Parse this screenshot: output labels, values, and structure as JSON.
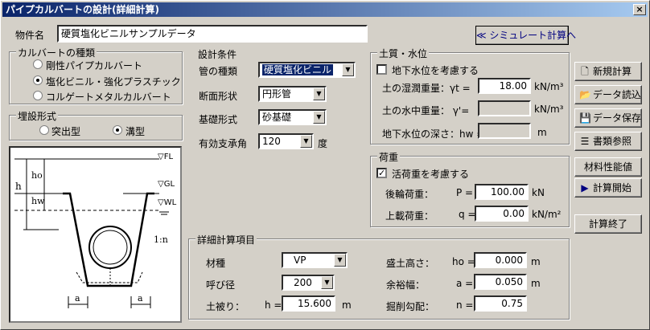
{
  "window": {
    "title": "パイプカルバートの設計(詳細計算)",
    "close_glyph": "×"
  },
  "project": {
    "label": "物件名",
    "value": "硬質塩化ビニルサンプルデータ"
  },
  "simulate_button": "≪ シミュレート計算へ",
  "culvert_type": {
    "title": "カルバートの種類",
    "options": [
      "剛性パイプカルバート",
      "塩化ビニル・強化プラスチック",
      "コルゲートメタルカルバート"
    ],
    "selected": 1
  },
  "burial": {
    "title": "埋設形式",
    "options": [
      "突出型",
      "溝型"
    ],
    "selected": 1
  },
  "diagram": {
    "fl": "▽FL",
    "gl": "▽GL",
    "wl": "▽WL",
    "h": "h",
    "ho": "ho",
    "hw": "hw",
    "slope": "1:n",
    "a1": "a",
    "a2": "a"
  },
  "design": {
    "title": "設計条件",
    "pipe_type_label": "管の種類",
    "pipe_type_value": "硬質塩化ビニル",
    "section_label": "断面形状",
    "section_value": "円形管",
    "base_label": "基礎形式",
    "base_value": "砂基礎",
    "angle_label": "有効支承角",
    "angle_value": "120",
    "angle_unit": "度"
  },
  "soil": {
    "title": "土質・水位",
    "gw_label": "地下水位を考慮する",
    "gw_checked": false,
    "wet_label": "土の湿潤重量：γt =",
    "wet_value": "18.00",
    "wet_unit": "kN/m³",
    "sub_label": "土の水中重量：  γ'=",
    "sub_value": "",
    "sub_unit": "kN/m³",
    "depth_label": "地下水位の深さ：hw =",
    "depth_value": "",
    "depth_unit": "m"
  },
  "load": {
    "title": "荷重",
    "live_label": "活荷重を考慮する",
    "live_checked": true,
    "wheel_label": "後輪荷重：",
    "wheel_sym": "P =",
    "wheel_value": "100.00",
    "wheel_unit": "kN",
    "surcharge_label": "上載荷重：",
    "surcharge_sym": "q =",
    "surcharge_value": "0.00",
    "surcharge_unit": "kN/m²"
  },
  "detail": {
    "title": "詳細計算項目",
    "material_label": "材種",
    "material_value": "VP",
    "nominal_label": "呼び径",
    "nominal_value": "200",
    "cover_label": "土被り：",
    "cover_sym": "h =",
    "cover_value": "15.600",
    "cover_unit": "m",
    "fill_label": "盛土高さ：",
    "fill_sym": "ho =",
    "fill_value": "0.000",
    "fill_unit": "m",
    "margin_label": "余裕幅：",
    "margin_sym": "a =",
    "margin_value": "0.050",
    "margin_unit": "m",
    "slope_label": "掘削勾配：",
    "slope_sym": "n =",
    "slope_value": "0.75"
  },
  "side_buttons": {
    "new": "新規計算",
    "load": "データ読込",
    "save": "データ保存",
    "ref": "書類参照",
    "material": "材料性能値",
    "start": "計算開始",
    "exit": "計算終了"
  }
}
